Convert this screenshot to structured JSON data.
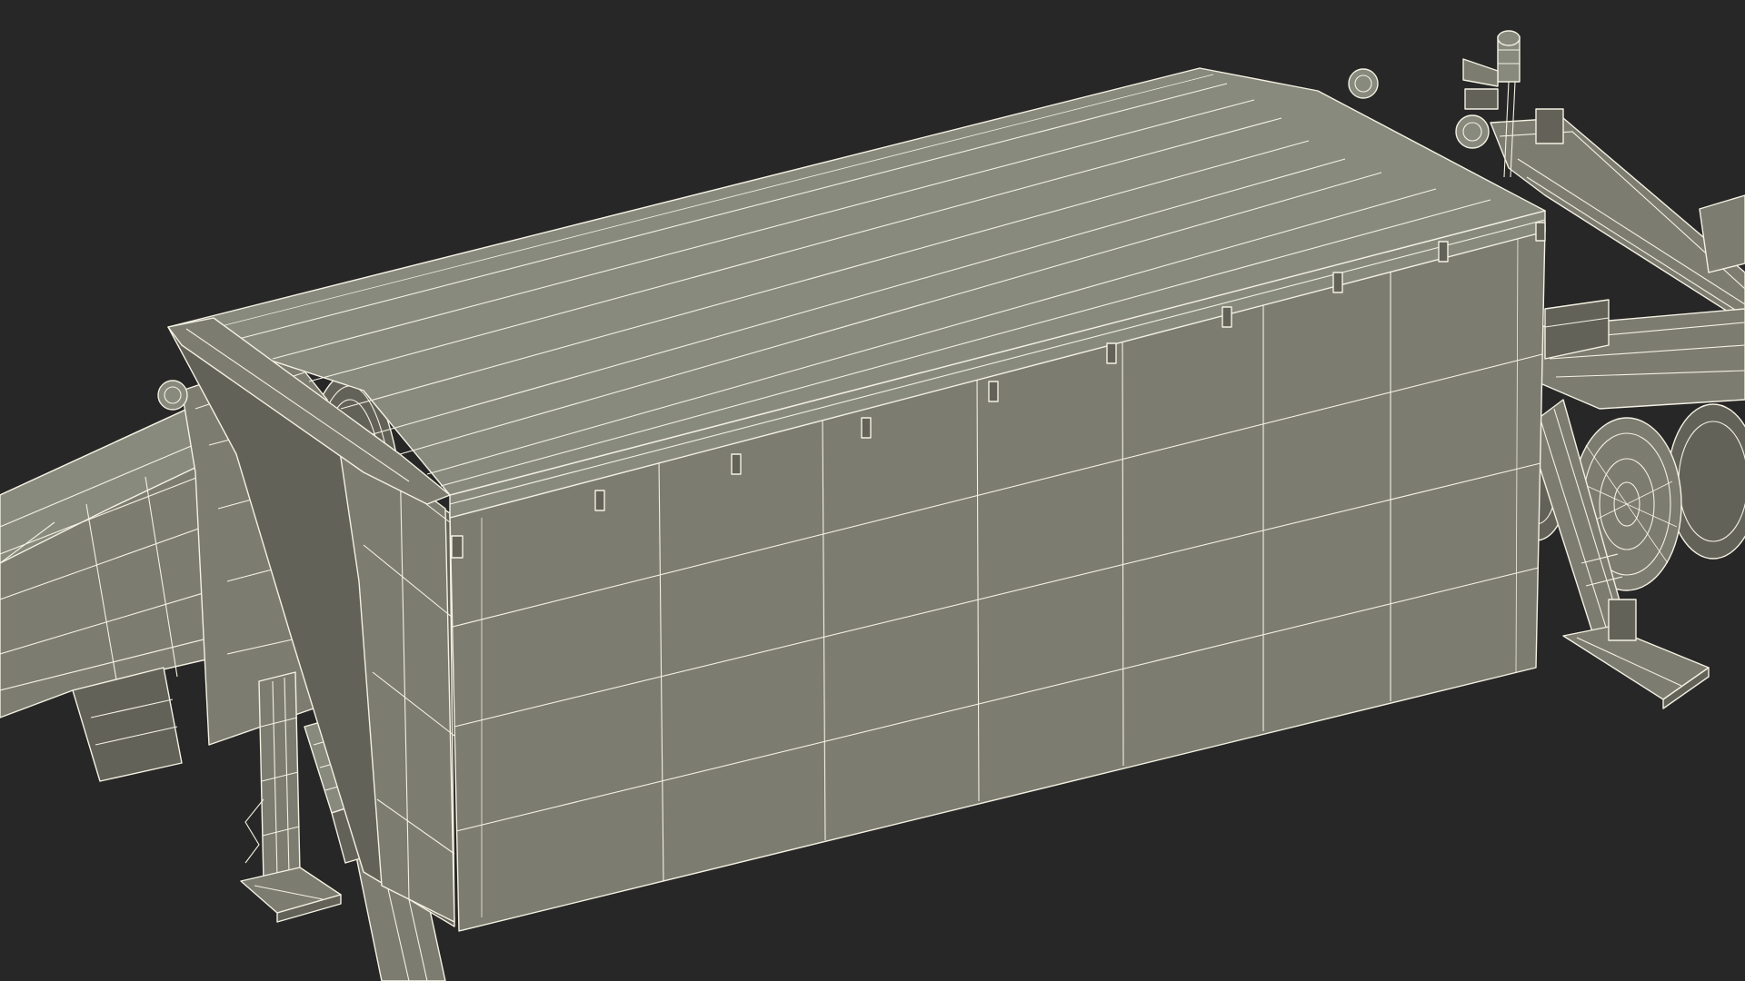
{
  "scene": {
    "subject": "launcher-trailer-wireframe-render",
    "colors": {
      "background": "#272727",
      "surface": "#7c7c71",
      "surface_light": "#8a8a7f",
      "surface_dark": "#5f5f56",
      "wire": "#f4f1e2"
    }
  }
}
